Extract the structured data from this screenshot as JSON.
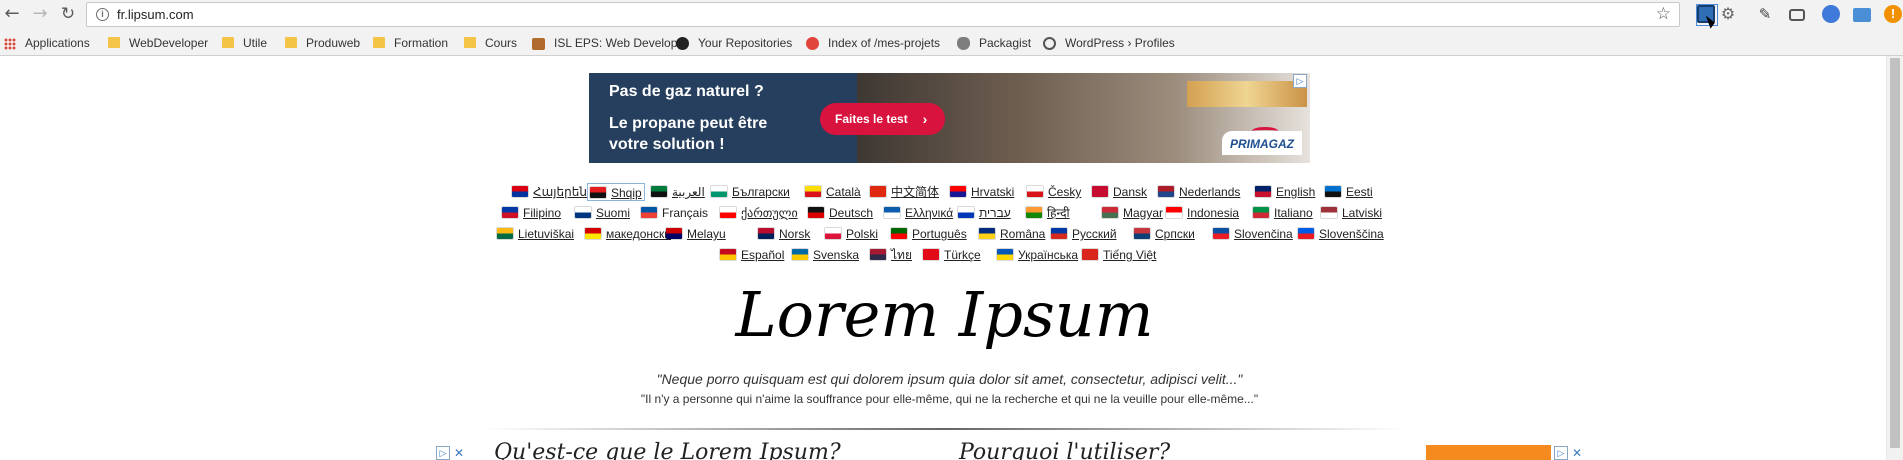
{
  "browser": {
    "url": "fr.lipsum.com",
    "bookmarks": [
      {
        "label": "Applications",
        "icon": "apps-grid-icon"
      },
      {
        "label": "WebDeveloper",
        "icon": "folder-icon"
      },
      {
        "label": "Utile",
        "icon": "folder-icon"
      },
      {
        "label": "Produweb",
        "icon": "folder-icon"
      },
      {
        "label": "Formation",
        "icon": "folder-icon"
      },
      {
        "label": "Cours",
        "icon": "folder-icon"
      },
      {
        "label": "ISL EPS: Web Develop",
        "icon": "isl-icon"
      },
      {
        "label": "Your Repositories",
        "icon": "github-icon"
      },
      {
        "label": "Index of /mes-projets",
        "icon": "server-icon"
      },
      {
        "label": "Packagist",
        "icon": "packagist-icon"
      },
      {
        "label": "WordPress › Profiles",
        "icon": "wordpress-icon"
      }
    ]
  },
  "ad": {
    "line1": "Pas de gaz naturel ?",
    "line2": "Le propane peut être votre solution !",
    "cta": "Faites le test",
    "brand": "PRIMAGAZ"
  },
  "languages": {
    "rows": [
      [
        {
          "label": "Հայերեն",
          "c1": "#d90012",
          "c2": "#0033a0"
        },
        {
          "label": "Shqip",
          "c1": "#e41e20",
          "c2": "#111111",
          "active": true
        },
        {
          "label": "العربية",
          "c1": "#007a3d",
          "c2": "#111111"
        },
        {
          "label": "Български",
          "c1": "#ffffff",
          "c2": "#00966e"
        },
        {
          "label": "Català",
          "c1": "#fcdd09",
          "c2": "#da121a"
        },
        {
          "label": "中文简体",
          "c1": "#de2910",
          "c2": "#de2910"
        },
        {
          "label": "Hrvatski",
          "c1": "#ff0000",
          "c2": "#171796"
        },
        {
          "label": "Česky",
          "c1": "#ffffff",
          "c2": "#d7141a"
        },
        {
          "label": "Dansk",
          "c1": "#c60c30",
          "c2": "#c60c30"
        },
        {
          "label": "Nederlands",
          "c1": "#ae1c28",
          "c2": "#21468b"
        },
        {
          "label": "English",
          "c1": "#012169",
          "c2": "#c8102e"
        },
        {
          "label": "Eesti",
          "c1": "#0072ce",
          "c2": "#111111"
        }
      ],
      [
        {
          "label": "Filipino",
          "c1": "#0038a8",
          "c2": "#ce1126"
        },
        {
          "label": "Suomi",
          "c1": "#ffffff",
          "c2": "#003580"
        },
        {
          "label": "Français",
          "c1": "#0055a4",
          "c2": "#ef4135",
          "plain": true
        },
        {
          "label": "ქართული",
          "c1": "#ffffff",
          "c2": "#ff0000"
        },
        {
          "label": "Deutsch",
          "c1": "#111111",
          "c2": "#dd0000"
        },
        {
          "label": "Ελληνικά",
          "c1": "#0d5eaf",
          "c2": "#ffffff"
        },
        {
          "label": "עברית",
          "c1": "#ffffff",
          "c2": "#0038b8"
        },
        {
          "label": "हिन्दी",
          "c1": "#ff9933",
          "c2": "#138808"
        },
        {
          "label": "Magyar",
          "c1": "#ce2939",
          "c2": "#477050"
        },
        {
          "label": "Indonesia",
          "c1": "#ff0000",
          "c2": "#ffffff"
        },
        {
          "label": "Italiano",
          "c1": "#009246",
          "c2": "#ce2b37"
        },
        {
          "label": "Latviski",
          "c1": "#9e3039",
          "c2": "#ffffff"
        }
      ],
      [
        {
          "label": "Lietuviškai",
          "c1": "#fdb913",
          "c2": "#006a44"
        },
        {
          "label": "македонски",
          "c1": "#d20000",
          "c2": "#ffe600"
        },
        {
          "label": "Melayu",
          "c1": "#cc0001",
          "c2": "#010066"
        },
        {
          "label": "Norsk",
          "c1": "#ba0c2f",
          "c2": "#00205b"
        },
        {
          "label": "Polski",
          "c1": "#ffffff",
          "c2": "#dc143c"
        },
        {
          "label": "Português",
          "c1": "#006600",
          "c2": "#ff0000"
        },
        {
          "label": "Româna",
          "c1": "#002b7f",
          "c2": "#fcd116"
        },
        {
          "label": "Pусский",
          "c1": "#0039a6",
          "c2": "#d52b1e"
        },
        {
          "label": "Српски",
          "c1": "#c6363c",
          "c2": "#0c4076"
        },
        {
          "label": "Slovenčina",
          "c1": "#0b4ea2",
          "c2": "#ee1c25"
        },
        {
          "label": "Slovenščina",
          "c1": "#005ce5",
          "c2": "#ed1c24"
        }
      ],
      [
        {
          "label": "Español",
          "c1": "#c60b1e",
          "c2": "#ffc400"
        },
        {
          "label": "Svenska",
          "c1": "#006aa7",
          "c2": "#fecc00"
        },
        {
          "label": "ไทย",
          "c1": "#a51931",
          "c2": "#2d2a4a"
        },
        {
          "label": "Türkçe",
          "c1": "#e30a17",
          "c2": "#e30a17"
        },
        {
          "label": "Українська",
          "c1": "#0057b7",
          "c2": "#ffd700"
        },
        {
          "label": "Tiếng Việt",
          "c1": "#da251d",
          "c2": "#da251d"
        }
      ]
    ]
  },
  "main": {
    "title": "Lorem Ipsum",
    "quote_latin": "\"Neque porro quisquam est qui dolorem ipsum quia dolor sit amet, consectetur, adipisci velit...\"",
    "quote_french": "\"Il n'y a personne qui n'aime la souffrance pour elle-même, qui ne la recherche et qui ne la veuille pour elle-même...\"",
    "section1": "Qu'est-ce que le Lorem Ipsum?",
    "section2": "Pourquoi l'utiliser?"
  },
  "colors": {
    "ad_bg": "#263f5e",
    "ad_cta": "#d8133e"
  }
}
